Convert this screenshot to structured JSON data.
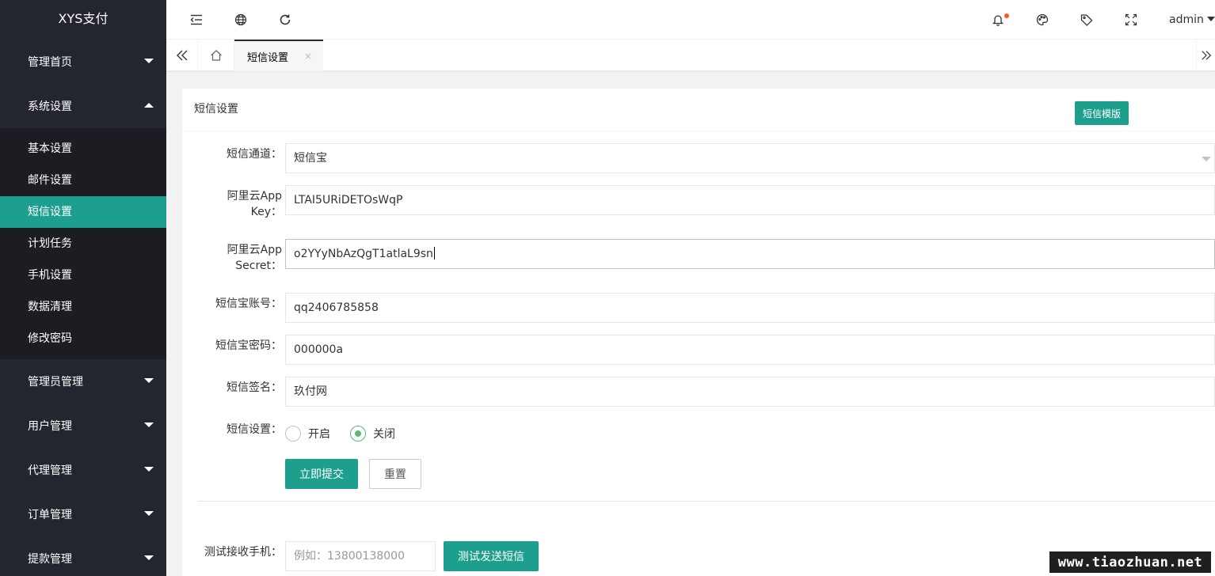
{
  "app": {
    "title": "XYS支付"
  },
  "sidebar": {
    "groups": [
      {
        "label": "管理首页"
      },
      {
        "label": "系统设置",
        "expanded": true,
        "items": [
          {
            "label": "基本设置"
          },
          {
            "label": "邮件设置"
          },
          {
            "label": "短信设置",
            "active": true
          },
          {
            "label": "计划任务"
          },
          {
            "label": "手机设置"
          },
          {
            "label": "数据清理"
          },
          {
            "label": "修改密码"
          }
        ]
      },
      {
        "label": "管理员管理"
      },
      {
        "label": "用户管理"
      },
      {
        "label": "代理管理"
      },
      {
        "label": "订单管理"
      },
      {
        "label": "提款管理"
      }
    ]
  },
  "header": {
    "icons": [
      "menu-collapse-icon",
      "globe-icon",
      "refresh-icon",
      "bell-icon",
      "theme-icon",
      "tag-icon",
      "fullscreen-icon"
    ],
    "user": "admin"
  },
  "tabs": {
    "active_label": "短信设置",
    "close_glyph": "×"
  },
  "card": {
    "title": "短信设置",
    "template_button": "短信模版"
  },
  "form": {
    "channel": {
      "label": "短信通道：",
      "value": "短信宝"
    },
    "app_key": {
      "label_line1": "阿里云App",
      "label_line2": "Key：",
      "value": "LTAI5URiDETOsWqP"
    },
    "app_secret": {
      "label_line1": "阿里云App",
      "label_line2": "Secret：",
      "value": "o2YYyNbAzQgT1atlaL9sn"
    },
    "account": {
      "label": "短信宝账号：",
      "value": "qq2406785858"
    },
    "password": {
      "label": "短信宝密码：",
      "value": "000000a"
    },
    "signature": {
      "label": "短信签名：",
      "value": "玖付网"
    },
    "switch": {
      "label": "短信设置：",
      "on_label": "开启",
      "off_label": "关闭",
      "selected": "关闭"
    },
    "submit_button": "立即提交",
    "reset_button": "重置"
  },
  "test": {
    "label": "测试接收手机：",
    "placeholder": "例如：13800138000",
    "send_button": "测试发送短信"
  },
  "watermark": "www.tiaozhuan.net",
  "colors": {
    "sidebar_bg": "#23262e",
    "accent": "#1e9f8e",
    "radio_on": "#5fb878",
    "notify_dot": "#ff5722"
  }
}
